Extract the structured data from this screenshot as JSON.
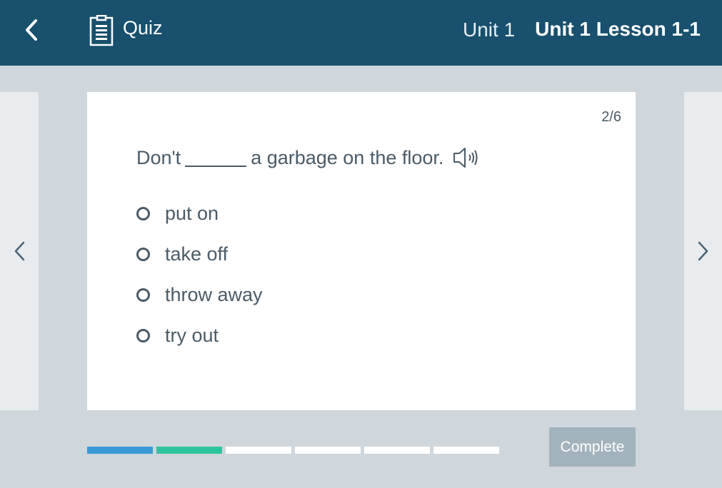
{
  "header": {
    "quiz_label": "Quiz",
    "unit_label": "Unit 1",
    "lesson_label": "Unit 1 Lesson 1-1",
    "background": "#18506d"
  },
  "question": {
    "counter": "2/6",
    "text_before": "Don't",
    "text_after": "a garbage on the floor.",
    "options": [
      {
        "label": "put on"
      },
      {
        "label": "take off"
      },
      {
        "label": "throw away"
      },
      {
        "label": "try out"
      }
    ]
  },
  "progress": {
    "total": 6,
    "current": 2,
    "segment_colors": [
      "#3a9ad6",
      "#2ec4a0",
      "#ffffff",
      "#ffffff",
      "#ffffff",
      "#ffffff"
    ]
  },
  "footer": {
    "complete_label": "Complete"
  },
  "icons": {
    "back": "chevron-left-icon",
    "quiz": "clipboard-icon",
    "audio": "speaker-icon",
    "prev": "chevron-left-icon",
    "next": "chevron-right-icon"
  }
}
